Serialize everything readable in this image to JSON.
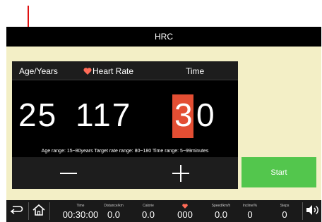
{
  "header": {
    "title": "HRC"
  },
  "panel": {
    "labels": {
      "age": "Age/Years",
      "heart_rate": "Heart Rate",
      "time": "Time"
    },
    "values": {
      "age": "25",
      "heart_rate": "117",
      "time_tens": "3",
      "time_ones": "0"
    },
    "range_note": "Age range: 15~80years Target rate range: 80~180 Time range: 5~99minutes"
  },
  "controls": {
    "start_label": "Start"
  },
  "status_bar": {
    "time_label": "Time",
    "time_value": "00:30:00",
    "distance_label": "Distance/km",
    "distance_value": "0.0",
    "calorie_label": "Calorie",
    "calorie_value": "0.0",
    "heart_value": "000",
    "speed_label": "Speed/km/h",
    "speed_value": "0.0",
    "incline_label": "Incline/%",
    "incline_value": "0",
    "steps_label": "Steps",
    "steps_value": "0"
  },
  "colors": {
    "accent": "#e34e33",
    "start": "#53c64d",
    "heart": "#ff6b57",
    "arrow": "#e01010"
  },
  "icons": [
    "back-icon",
    "home-icon",
    "heart-icon",
    "volume-icon"
  ]
}
